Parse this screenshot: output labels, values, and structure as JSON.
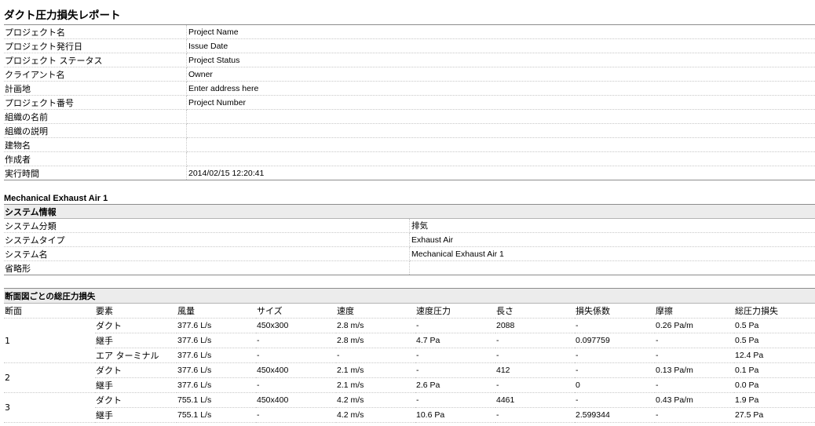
{
  "report": {
    "title": "ダクト圧力損失レポート"
  },
  "project_info": [
    {
      "label": "プロジェクト名",
      "value": "Project Name"
    },
    {
      "label": "プロジェクト発行日",
      "value": "Issue Date"
    },
    {
      "label": "プロジェクト ステータス",
      "value": "Project Status"
    },
    {
      "label": "クライアント名",
      "value": "Owner"
    },
    {
      "label": "計画地",
      "value": "Enter address here"
    },
    {
      "label": "プロジェクト番号",
      "value": "Project Number"
    },
    {
      "label": "組織の名前",
      "value": ""
    },
    {
      "label": "組織の説明",
      "value": ""
    },
    {
      "label": "建物名",
      "value": ""
    },
    {
      "label": "作成者",
      "value": ""
    },
    {
      "label": "実行時間",
      "value": "2014/02/15 12:20:41"
    }
  ],
  "system": {
    "name": "Mechanical Exhaust Air 1",
    "section_title": "システム情報",
    "rows": [
      {
        "label": "システム分類",
        "value": "排気"
      },
      {
        "label": "システムタイプ",
        "value": "Exhaust Air"
      },
      {
        "label": "システム名",
        "value": "Mechanical Exhaust Air 1"
      },
      {
        "label": "省略形",
        "value": ""
      }
    ]
  },
  "loss_table": {
    "section_title": "断面図ごとの総圧力損失",
    "columns": [
      "断面",
      "要素",
      "風量",
      "サイズ",
      "速度",
      "速度圧力",
      "長さ",
      "損失係数",
      "摩擦",
      "総圧力損失"
    ],
    "sections": [
      {
        "section": "1",
        "rows": [
          [
            "ダクト",
            "377.6 L/s",
            "450x300",
            "2.8 m/s",
            "-",
            "2088",
            "-",
            "0.26 Pa/m",
            "0.5 Pa"
          ],
          [
            "継手",
            "377.6 L/s",
            "-",
            "2.8 m/s",
            "4.7 Pa",
            "-",
            "0.097759",
            "-",
            "0.5 Pa"
          ],
          [
            "エア ターミナル",
            "377.6 L/s",
            "-",
            "-",
            "-",
            "-",
            "-",
            "-",
            "12.4 Pa"
          ]
        ]
      },
      {
        "section": "2",
        "rows": [
          [
            "ダクト",
            "377.6 L/s",
            "450x400",
            "2.1 m/s",
            "-",
            "412",
            "-",
            "0.13 Pa/m",
            "0.1 Pa"
          ],
          [
            "継手",
            "377.6 L/s",
            "-",
            "2.1 m/s",
            "2.6 Pa",
            "-",
            "0",
            "-",
            "0.0 Pa"
          ]
        ]
      },
      {
        "section": "3",
        "rows": [
          [
            "ダクト",
            "755.1 L/s",
            "450x400",
            "4.2 m/s",
            "-",
            "4461",
            "-",
            "0.43 Pa/m",
            "1.9 Pa"
          ],
          [
            "継手",
            "755.1 L/s",
            "-",
            "4.2 m/s",
            "10.6 Pa",
            "-",
            "2.599344",
            "-",
            "27.5 Pa"
          ]
        ]
      }
    ]
  }
}
